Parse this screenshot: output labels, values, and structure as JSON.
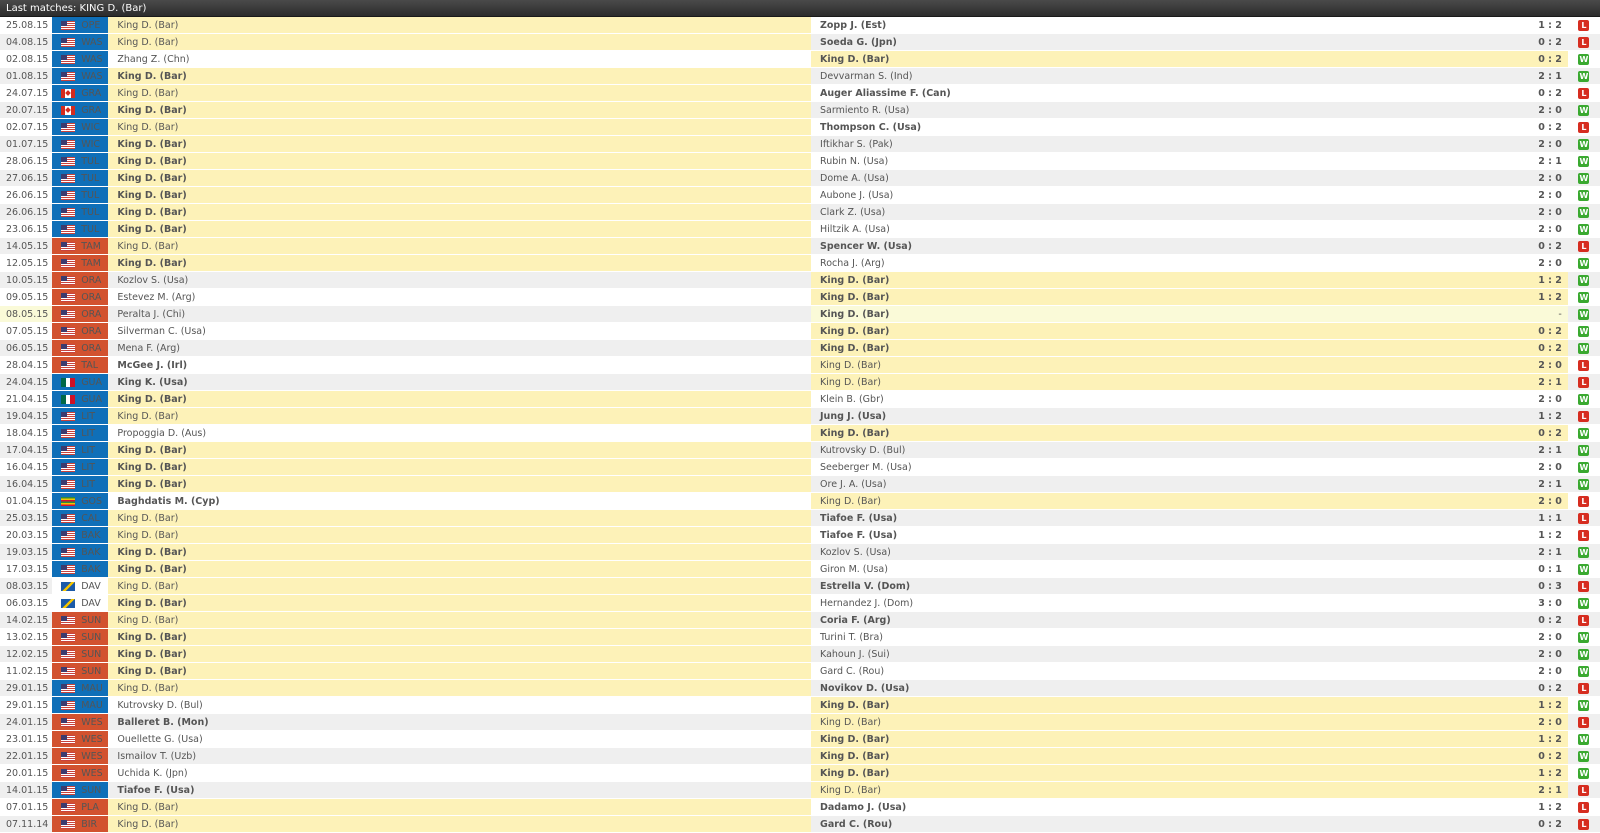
{
  "header": {
    "title": "Last matches: KING D. (Bar)"
  },
  "colors": {
    "tour_blue": "#0f6fb8",
    "tour_red": "#d2522f",
    "highlight": "#fdf2b8",
    "win": "#3aa930",
    "loss": "#d62d20"
  },
  "matches": [
    {
      "date": "25.08.15",
      "flag": "us",
      "tourn": "OPE",
      "tcolor": "blue",
      "p1": "King D. (Bar)",
      "p2": "Zopp J. (Est)",
      "score": "1 : 2",
      "result": "L",
      "king": "p1",
      "winner": "p2"
    },
    {
      "date": "04.08.15",
      "flag": "us",
      "tourn": "WAS",
      "tcolor": "blue",
      "p1": "King D. (Bar)",
      "p2": "Soeda G. (Jpn)",
      "score": "0 : 2",
      "result": "L",
      "king": "p1",
      "winner": "p2"
    },
    {
      "date": "02.08.15",
      "flag": "us",
      "tourn": "WAS",
      "tcolor": "blue",
      "p1": "Zhang Z. (Chn)",
      "p2": "King D. (Bar)",
      "score": "0 : 2",
      "result": "W",
      "king": "p2",
      "winner": "p2"
    },
    {
      "date": "01.08.15",
      "flag": "us",
      "tourn": "WAS",
      "tcolor": "blue",
      "p1": "King D. (Bar)",
      "p2": "Devvarman S. (Ind)",
      "score": "2 : 1",
      "result": "W",
      "king": "p1",
      "winner": "p1"
    },
    {
      "date": "24.07.15",
      "flag": "ca",
      "tourn": "GRA",
      "tcolor": "blue",
      "p1": "King D. (Bar)",
      "p2": "Auger Aliassime F. (Can)",
      "score": "0 : 2",
      "result": "L",
      "king": "p1",
      "winner": "p2"
    },
    {
      "date": "20.07.15",
      "flag": "ca",
      "tourn": "GRA",
      "tcolor": "blue",
      "p1": "King D. (Bar)",
      "p2": "Sarmiento R. (Usa)",
      "score": "2 : 0",
      "result": "W",
      "king": "p1",
      "winner": "p1"
    },
    {
      "date": "02.07.15",
      "flag": "us",
      "tourn": "WIC",
      "tcolor": "blue",
      "p1": "King D. (Bar)",
      "p2": "Thompson C. (Usa)",
      "score": "0 : 2",
      "result": "L",
      "king": "p1",
      "winner": "p2"
    },
    {
      "date": "01.07.15",
      "flag": "us",
      "tourn": "WIC",
      "tcolor": "blue",
      "p1": "King D. (Bar)",
      "p2": "Iftikhar S. (Pak)",
      "score": "2 : 0",
      "result": "W",
      "king": "p1",
      "winner": "p1"
    },
    {
      "date": "28.06.15",
      "flag": "us",
      "tourn": "TUL",
      "tcolor": "blue",
      "p1": "King D. (Bar)",
      "p2": "Rubin N. (Usa)",
      "score": "2 : 1",
      "result": "W",
      "king": "p1",
      "winner": "p1"
    },
    {
      "date": "27.06.15",
      "flag": "us",
      "tourn": "TUL",
      "tcolor": "blue",
      "p1": "King D. (Bar)",
      "p2": "Dome A. (Usa)",
      "score": "2 : 0",
      "result": "W",
      "king": "p1",
      "winner": "p1"
    },
    {
      "date": "26.06.15",
      "flag": "us",
      "tourn": "TUL",
      "tcolor": "blue",
      "p1": "King D. (Bar)",
      "p2": "Aubone J. (Usa)",
      "score": "2 : 0",
      "result": "W",
      "king": "p1",
      "winner": "p1"
    },
    {
      "date": "26.06.15",
      "flag": "us",
      "tourn": "TUL",
      "tcolor": "blue",
      "p1": "King D. (Bar)",
      "p2": "Clark Z. (Usa)",
      "score": "2 : 0",
      "result": "W",
      "king": "p1",
      "winner": "p1"
    },
    {
      "date": "23.06.15",
      "flag": "us",
      "tourn": "TUL",
      "tcolor": "blue",
      "p1": "King D. (Bar)",
      "p2": "Hiltzik A. (Usa)",
      "score": "2 : 0",
      "result": "W",
      "king": "p1",
      "winner": "p1"
    },
    {
      "date": "14.05.15",
      "flag": "us",
      "tourn": "TAM",
      "tcolor": "red",
      "p1": "King D. (Bar)",
      "p2": "Spencer W. (Usa)",
      "score": "0 : 2",
      "result": "L",
      "king": "p1",
      "winner": "p2"
    },
    {
      "date": "12.05.15",
      "flag": "us",
      "tourn": "TAM",
      "tcolor": "red",
      "p1": "King D. (Bar)",
      "p2": "Rocha J. (Arg)",
      "score": "2 : 0",
      "result": "W",
      "king": "p1",
      "winner": "p1"
    },
    {
      "date": "10.05.15",
      "flag": "us",
      "tourn": "ORA",
      "tcolor": "red",
      "p1": "Kozlov S. (Usa)",
      "p2": "King D. (Bar)",
      "score": "1 : 2",
      "result": "W",
      "king": "p2",
      "winner": "p2"
    },
    {
      "date": "09.05.15",
      "flag": "us",
      "tourn": "ORA",
      "tcolor": "red",
      "p1": "Estevez M. (Arg)",
      "p2": "King D. (Bar)",
      "score": "1 : 2",
      "result": "W",
      "king": "p2",
      "winner": "p2"
    },
    {
      "date": "08.05.15",
      "flag": "us",
      "tourn": "ORA",
      "tcolor": "red",
      "p1": "Peralta J. (Chi)",
      "p2": "King D. (Bar)",
      "score": "-",
      "result": "W",
      "king": "p2",
      "winner": "p2",
      "pale": true
    },
    {
      "date": "07.05.15",
      "flag": "us",
      "tourn": "ORA",
      "tcolor": "red",
      "p1": "Silverman C. (Usa)",
      "p2": "King D. (Bar)",
      "score": "0 : 2",
      "result": "W",
      "king": "p2",
      "winner": "p2"
    },
    {
      "date": "06.05.15",
      "flag": "us",
      "tourn": "ORA",
      "tcolor": "red",
      "p1": "Mena F. (Arg)",
      "p2": "King D. (Bar)",
      "score": "0 : 2",
      "result": "W",
      "king": "p2",
      "winner": "p2"
    },
    {
      "date": "28.04.15",
      "flag": "us",
      "tourn": "TAL",
      "tcolor": "red",
      "p1": "McGee J. (Irl)",
      "p2": "King D. (Bar)",
      "score": "2 : 0",
      "result": "L",
      "king": "p2",
      "winner": "p1"
    },
    {
      "date": "24.04.15",
      "flag": "mx",
      "tourn": "GUA",
      "tcolor": "blue",
      "p1": "King K. (Usa)",
      "p2": "King D. (Bar)",
      "score": "2 : 1",
      "result": "L",
      "king": "p2",
      "winner": "p1"
    },
    {
      "date": "21.04.15",
      "flag": "mx",
      "tourn": "GUA",
      "tcolor": "blue",
      "p1": "King D. (Bar)",
      "p2": "Klein B. (Gbr)",
      "score": "2 : 0",
      "result": "W",
      "king": "p1",
      "winner": "p1"
    },
    {
      "date": "19.04.15",
      "flag": "us",
      "tourn": "LIT",
      "tcolor": "blue",
      "p1": "King D. (Bar)",
      "p2": "Jung J. (Usa)",
      "score": "1 : 2",
      "result": "L",
      "king": "p1",
      "winner": "p2"
    },
    {
      "date": "18.04.15",
      "flag": "us",
      "tourn": "LIT",
      "tcolor": "blue",
      "p1": "Propoggia D. (Aus)",
      "p2": "King D. (Bar)",
      "score": "0 : 2",
      "result": "W",
      "king": "p2",
      "winner": "p2"
    },
    {
      "date": "17.04.15",
      "flag": "us",
      "tourn": "LIT",
      "tcolor": "blue",
      "p1": "King D. (Bar)",
      "p2": "Kutrovsky D. (Bul)",
      "score": "2 : 1",
      "result": "W",
      "king": "p1",
      "winner": "p1"
    },
    {
      "date": "16.04.15",
      "flag": "us",
      "tourn": "LIT",
      "tcolor": "blue",
      "p1": "King D. (Bar)",
      "p2": "Seeberger M. (Usa)",
      "score": "2 : 0",
      "result": "W",
      "king": "p1",
      "winner": "p1"
    },
    {
      "date": "16.04.15",
      "flag": "us",
      "tourn": "LIT",
      "tcolor": "blue",
      "p1": "King D. (Bar)",
      "p2": "Ore J. A. (Usa)",
      "score": "2 : 1",
      "result": "W",
      "king": "p1",
      "winner": "p1"
    },
    {
      "date": "01.04.15",
      "flag": "zw",
      "tourn": "GOS",
      "tcolor": "blue",
      "p1": "Baghdatis M. (Cyp)",
      "p2": "King D. (Bar)",
      "score": "2 : 0",
      "result": "L",
      "king": "p2",
      "winner": "p1"
    },
    {
      "date": "25.03.15",
      "flag": "us",
      "tourn": "CAL",
      "tcolor": "blue",
      "p1": "King D. (Bar)",
      "p2": "Tiafoe F. (Usa)",
      "score": "1 : 1",
      "result": "L",
      "king": "p1",
      "winner": "p2"
    },
    {
      "date": "20.03.15",
      "flag": "us",
      "tourn": "BAK",
      "tcolor": "blue",
      "p1": "King D. (Bar)",
      "p2": "Tiafoe F. (Usa)",
      "score": "1 : 2",
      "result": "L",
      "king": "p1",
      "winner": "p2"
    },
    {
      "date": "19.03.15",
      "flag": "us",
      "tourn": "BAK",
      "tcolor": "blue",
      "p1": "King D. (Bar)",
      "p2": "Kozlov S. (Usa)",
      "score": "2 : 1",
      "result": "W",
      "king": "p1",
      "winner": "p1"
    },
    {
      "date": "17.03.15",
      "flag": "us",
      "tourn": "BAK",
      "tcolor": "blue",
      "p1": "King D. (Bar)",
      "p2": "Giron M. (Usa)",
      "score": "0 : 1",
      "result": "W",
      "king": "p1",
      "winner": "p1"
    },
    {
      "date": "08.03.15",
      "flag": "dav",
      "tourn": "DAV",
      "tcolor": "white",
      "p1": "King D. (Bar)",
      "p2": "Estrella V. (Dom)",
      "score": "0 : 3",
      "result": "L",
      "king": "p1",
      "winner": "p2"
    },
    {
      "date": "06.03.15",
      "flag": "dav",
      "tourn": "DAV",
      "tcolor": "white",
      "p1": "King D. (Bar)",
      "p2": "Hernandez J. (Dom)",
      "score": "3 : 0",
      "result": "W",
      "king": "p1",
      "winner": "p1"
    },
    {
      "date": "14.02.15",
      "flag": "us",
      "tourn": "SUN",
      "tcolor": "red",
      "p1": "King D. (Bar)",
      "p2": "Coria F. (Arg)",
      "score": "0 : 2",
      "result": "L",
      "king": "p1",
      "winner": "p2"
    },
    {
      "date": "13.02.15",
      "flag": "us",
      "tourn": "SUN",
      "tcolor": "red",
      "p1": "King D. (Bar)",
      "p2": "Turini T. (Bra)",
      "score": "2 : 0",
      "result": "W",
      "king": "p1",
      "winner": "p1"
    },
    {
      "date": "12.02.15",
      "flag": "us",
      "tourn": "SUN",
      "tcolor": "red",
      "p1": "King D. (Bar)",
      "p2": "Kahoun J. (Sui)",
      "score": "2 : 0",
      "result": "W",
      "king": "p1",
      "winner": "p1"
    },
    {
      "date": "11.02.15",
      "flag": "us",
      "tourn": "SUN",
      "tcolor": "red",
      "p1": "King D. (Bar)",
      "p2": "Gard C. (Rou)",
      "score": "2 : 0",
      "result": "W",
      "king": "p1",
      "winner": "p1"
    },
    {
      "date": "29.01.15",
      "flag": "us",
      "tourn": "MAU",
      "tcolor": "blue",
      "p1": "King D. (Bar)",
      "p2": "Novikov D. (Usa)",
      "score": "0 : 2",
      "result": "L",
      "king": "p1",
      "winner": "p2"
    },
    {
      "date": "29.01.15",
      "flag": "us",
      "tourn": "MAU",
      "tcolor": "blue",
      "p1": "Kutrovsky D. (Bul)",
      "p2": "King D. (Bar)",
      "score": "1 : 2",
      "result": "W",
      "king": "p2",
      "winner": "p2"
    },
    {
      "date": "24.01.15",
      "flag": "us",
      "tourn": "WES",
      "tcolor": "red",
      "p1": "Balleret B. (Mon)",
      "p2": "King D. (Bar)",
      "score": "2 : 0",
      "result": "L",
      "king": "p2",
      "winner": "p1"
    },
    {
      "date": "23.01.15",
      "flag": "us",
      "tourn": "WES",
      "tcolor": "red",
      "p1": "Ouellette G. (Usa)",
      "p2": "King D. (Bar)",
      "score": "1 : 2",
      "result": "W",
      "king": "p2",
      "winner": "p2"
    },
    {
      "date": "22.01.15",
      "flag": "us",
      "tourn": "WES",
      "tcolor": "red",
      "p1": "Ismailov T. (Uzb)",
      "p2": "King D. (Bar)",
      "score": "0 : 2",
      "result": "W",
      "king": "p2",
      "winner": "p2"
    },
    {
      "date": "20.01.15",
      "flag": "us",
      "tourn": "WES",
      "tcolor": "red",
      "p1": "Uchida K. (Jpn)",
      "p2": "King D. (Bar)",
      "score": "1 : 2",
      "result": "W",
      "king": "p2",
      "winner": "p2"
    },
    {
      "date": "14.01.15",
      "flag": "us",
      "tourn": "SUN",
      "tcolor": "blue",
      "p1": "Tiafoe F. (Usa)",
      "p2": "King D. (Bar)",
      "score": "2 : 1",
      "result": "L",
      "king": "p2",
      "winner": "p1"
    },
    {
      "date": "07.01.15",
      "flag": "us",
      "tourn": "PLA",
      "tcolor": "red",
      "p1": "King D. (Bar)",
      "p2": "Dadamo J. (Usa)",
      "score": "1 : 2",
      "result": "L",
      "king": "p1",
      "winner": "p2"
    },
    {
      "date": "07.11.14",
      "flag": "us",
      "tourn": "BIR",
      "tcolor": "red",
      "p1": "King D. (Bar)",
      "p2": "Gard C. (Rou)",
      "score": "0 : 2",
      "result": "L",
      "king": "p1",
      "winner": "p2"
    }
  ]
}
